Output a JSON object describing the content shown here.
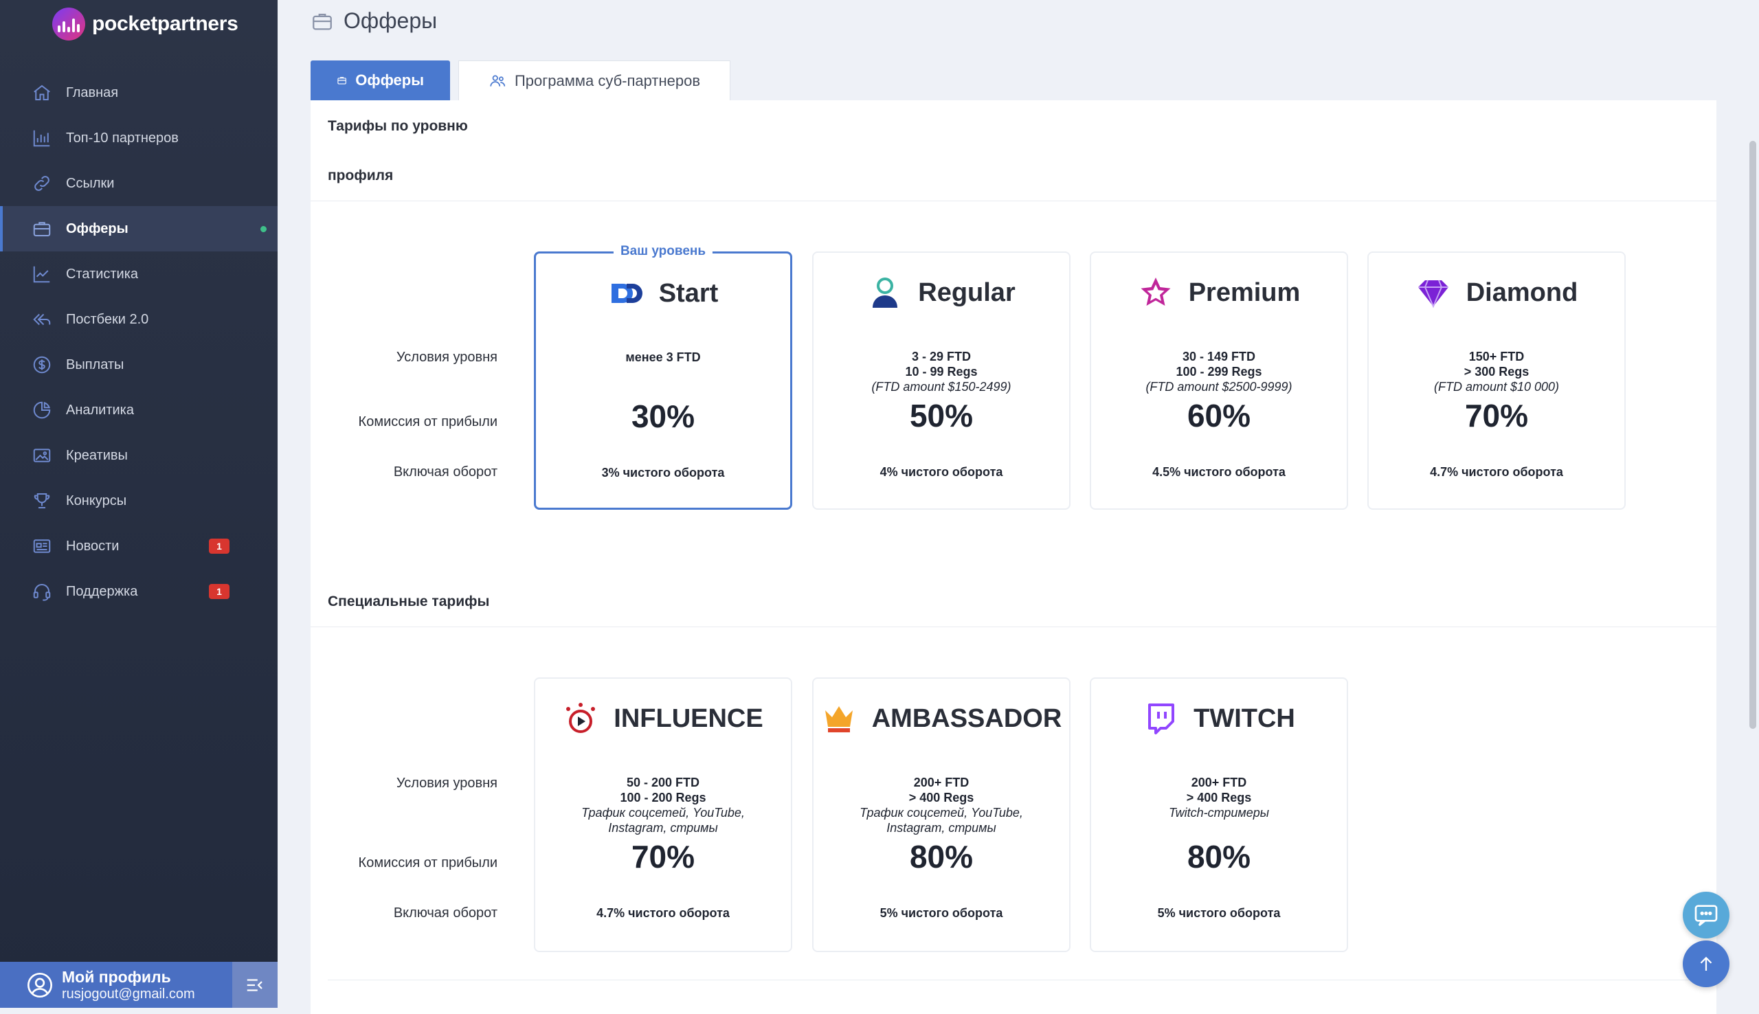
{
  "brand": {
    "name": "pocketpartners"
  },
  "sidebar": {
    "items": [
      {
        "label": "Главная",
        "icon": "home-icon"
      },
      {
        "label": "Топ-10 партнеров",
        "icon": "bar-chart-icon"
      },
      {
        "label": "Ссылки",
        "icon": "link-icon"
      },
      {
        "label": "Офферы",
        "icon": "briefcase-icon",
        "active": true
      },
      {
        "label": "Статистика",
        "icon": "line-chart-icon"
      },
      {
        "label": "Постбеки 2.0",
        "icon": "postback-icon"
      },
      {
        "label": "Выплаты",
        "icon": "dollar-coin-icon"
      },
      {
        "label": "Аналитика",
        "icon": "pie-chart-icon"
      },
      {
        "label": "Креативы",
        "icon": "image-icon"
      },
      {
        "label": "Конкурсы",
        "icon": "trophy-icon"
      },
      {
        "label": "Новости",
        "icon": "newspaper-icon",
        "badge": "1"
      },
      {
        "label": "Поддержка",
        "icon": "headset-icon",
        "badge": "1"
      }
    ]
  },
  "profile": {
    "name": "Мой профиль",
    "email": "rusjogout@gmail.com"
  },
  "page": {
    "title": "Офферы"
  },
  "tabs": [
    {
      "label": "Офферы"
    },
    {
      "label": "Программа суб-партнеров"
    }
  ],
  "sections": {
    "profile_levels": {
      "title_line1": "Тарифы по уровню",
      "title_line2": "профиля"
    },
    "special": {
      "title": "Специальные тарифы"
    }
  },
  "row_labels": {
    "conditions": "Условия уровня",
    "commission": "Комиссия от прибыли",
    "turnover": "Включая оборот"
  },
  "current_level_badge": "Ваш уровень",
  "levels": [
    {
      "name": "Start",
      "icon": "start-logo-icon",
      "conditions_bold": [
        "менее 3 FTD"
      ],
      "conditions_italic": [],
      "commission": "30%",
      "turnover": "3% чистого оборота",
      "current": true
    },
    {
      "name": "Regular",
      "icon": "user-icon",
      "conditions_bold": [
        "3 - 29 FTD",
        "10 - 99 Regs"
      ],
      "conditions_italic": [
        "(FTD amount $150-2499)"
      ],
      "commission": "50%",
      "turnover": "4% чистого оборота"
    },
    {
      "name": "Premium",
      "icon": "star-icon",
      "conditions_bold": [
        "30 - 149 FTD",
        "100 - 299 Regs"
      ],
      "conditions_italic": [
        "(FTD amount $2500-9999)"
      ],
      "commission": "60%",
      "turnover": "4.5% чистого оборота"
    },
    {
      "name": "Diamond",
      "icon": "diamond-icon",
      "conditions_bold": [
        "150+ FTD",
        "> 300 Regs"
      ],
      "conditions_italic": [
        "(FTD amount $10 000)"
      ],
      "commission": "70%",
      "turnover": "4.7% чистого оборота"
    }
  ],
  "special_levels": [
    {
      "name": "INFLUENCE",
      "icon": "influence-icon",
      "conditions_bold": [
        "50 - 200 FTD",
        "100 - 200 Regs"
      ],
      "conditions_italic": [
        "Трафик соцсетей, YouTube,",
        "Instagram, стримы"
      ],
      "commission": "70%",
      "turnover": "4.7% чистого оборота"
    },
    {
      "name": "AMBASSADOR",
      "icon": "crown-icon",
      "conditions_bold": [
        "200+ FTD",
        "> 400 Regs"
      ],
      "conditions_italic": [
        "Трафик соцсетей, YouTube,",
        "Instagram, стримы"
      ],
      "commission": "80%",
      "turnover": "5% чистого оборота"
    },
    {
      "name": "TWITCH",
      "icon": "twitch-icon",
      "conditions_bold": [
        "200+ FTD",
        "> 400 Regs"
      ],
      "conditions_italic": [
        "Twitch-стримеры"
      ],
      "commission": "80%",
      "turnover": "5% чистого оборота"
    }
  ],
  "colors": {
    "accent": "#4a79cf",
    "sidebar": "#2c3447",
    "badge": "#d8362f"
  }
}
